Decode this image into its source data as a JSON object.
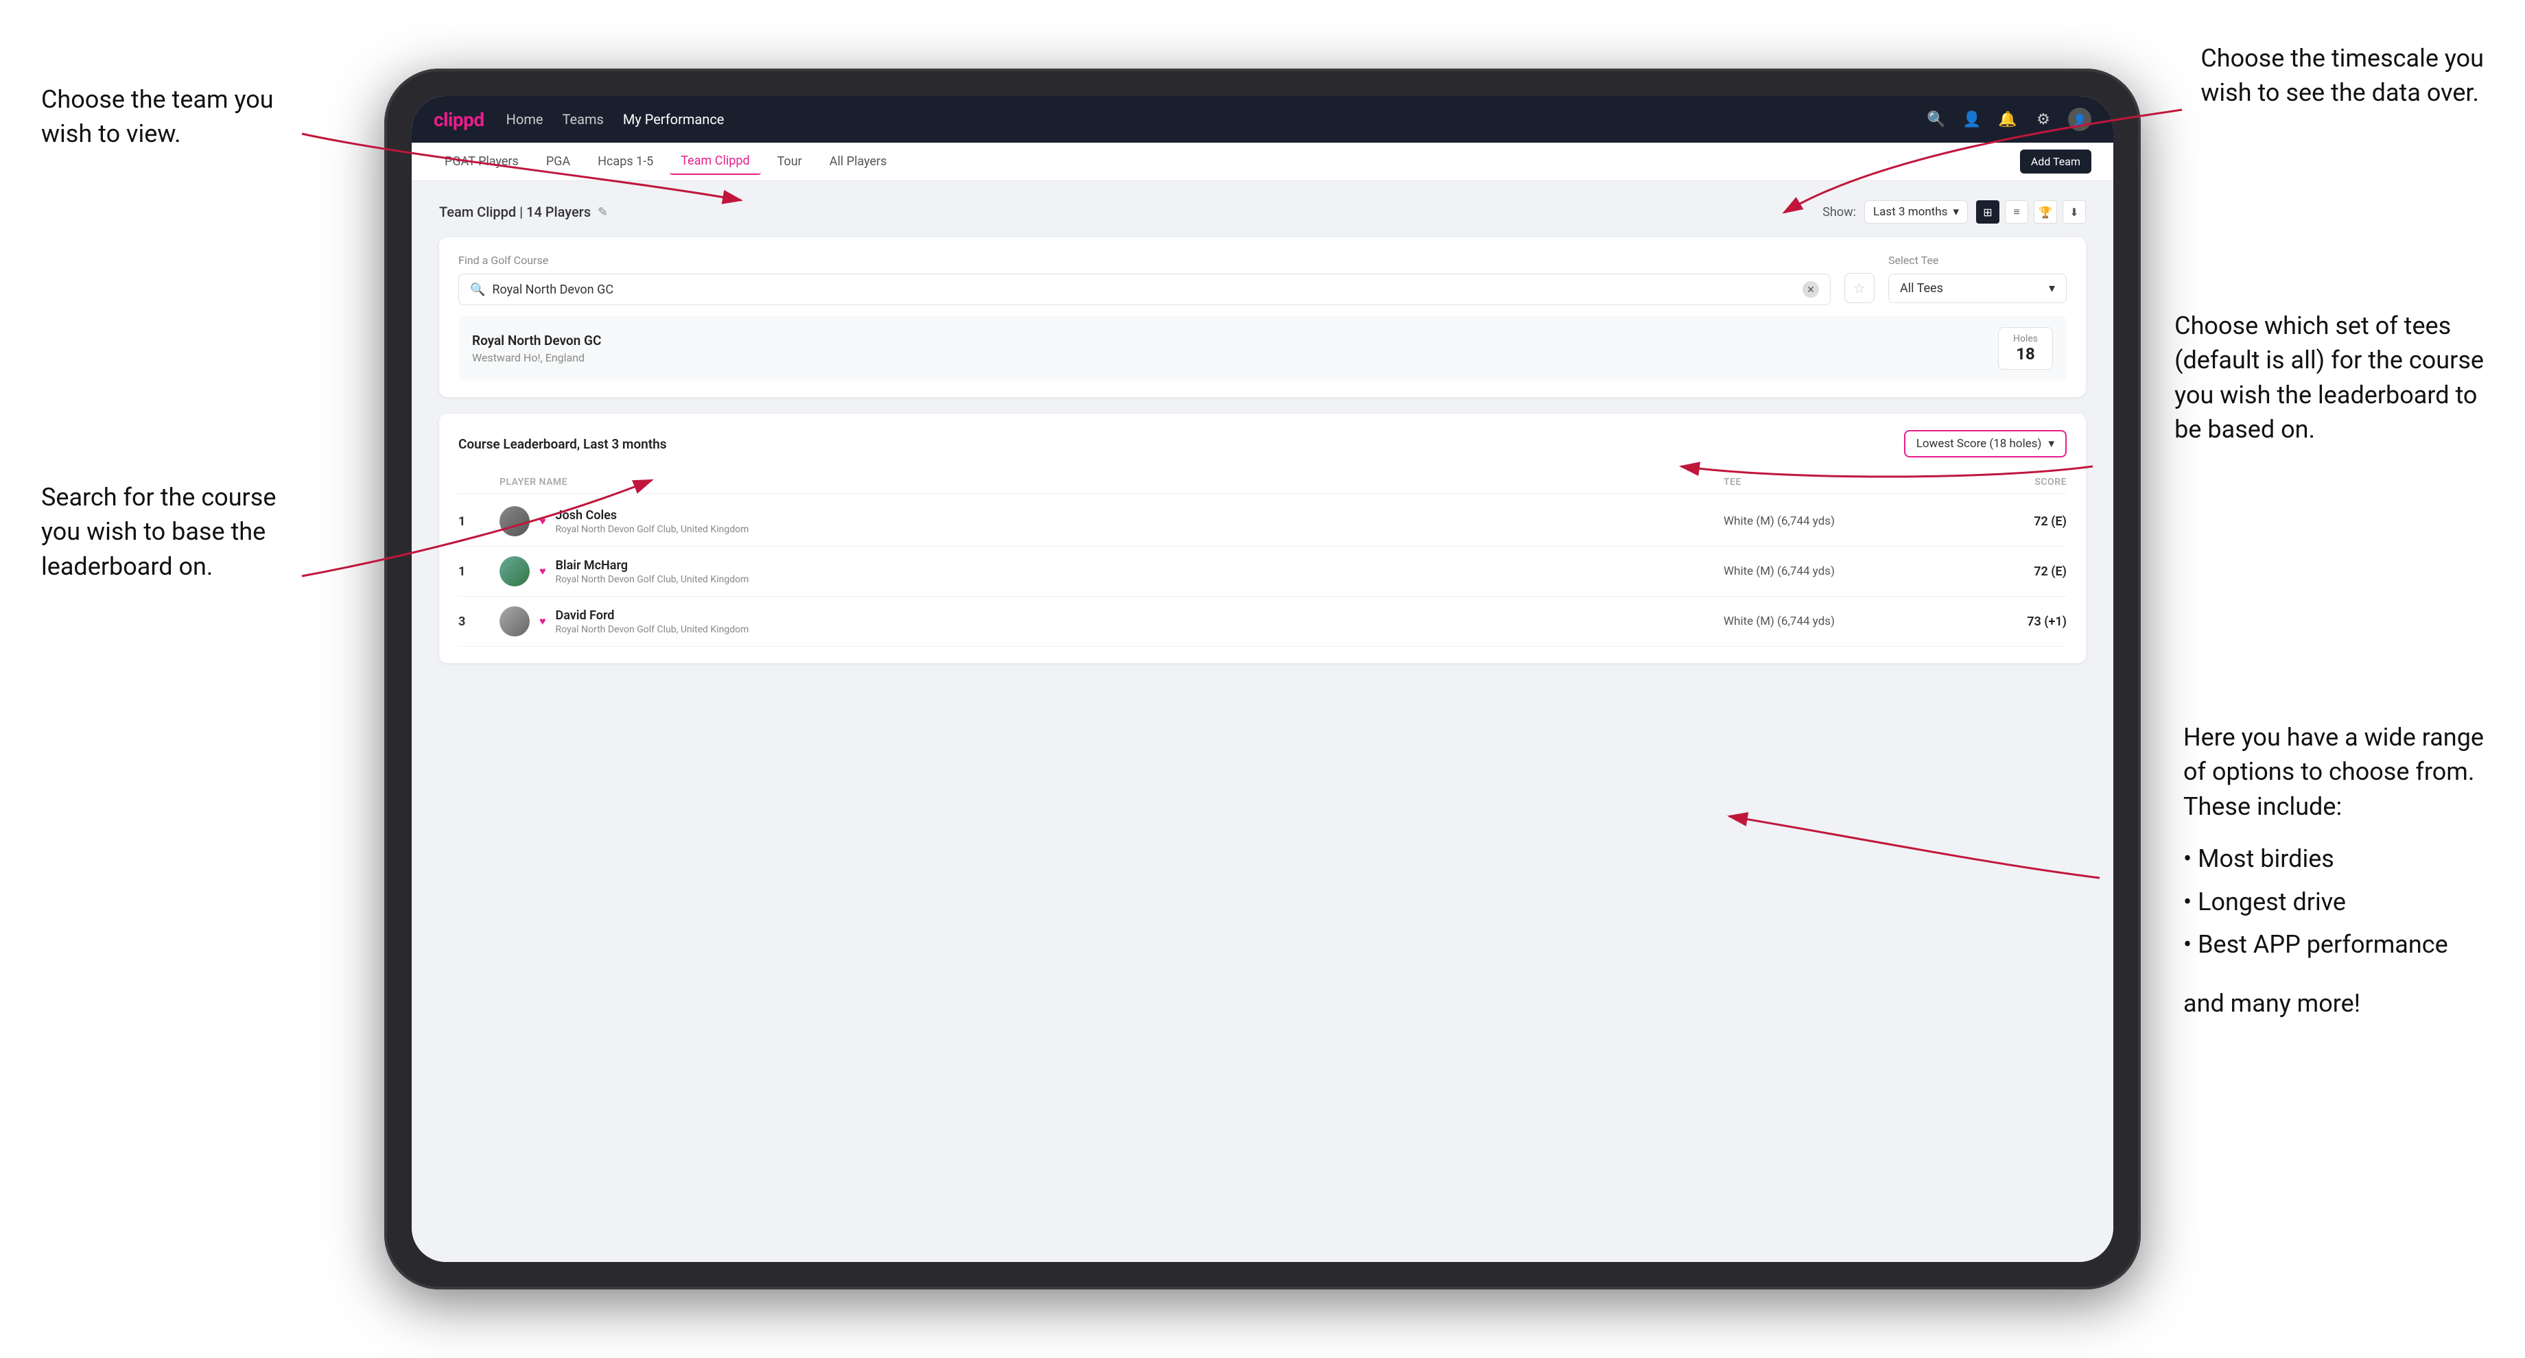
{
  "annotations": {
    "top_left_title": "Choose the team you\nwish to view.",
    "top_right_title": "Choose the timescale you\nwish to see the data over.",
    "mid_left_title": "Search for the course\nyou wish to base the\nleaderboard on.",
    "right_tee_title": "Choose which set of tees\n(default is all) for the course\nyou wish the leaderboard to\nbe based on.",
    "bottom_right_title": "Here you have a wide range\nof options to choose from.\nThese include:",
    "bullet_items": [
      "Most birdies",
      "Longest drive",
      "Best APP performance"
    ],
    "and_more": "and many more!"
  },
  "navbar": {
    "brand": "clippd",
    "links": [
      "Home",
      "Teams",
      "My Performance"
    ],
    "active_link": "My Performance"
  },
  "subnav": {
    "items": [
      "PGAT Players",
      "PGA",
      "Hcaps 1-5",
      "Team Clippd",
      "Tour",
      "All Players"
    ],
    "active_item": "Team Clippd",
    "add_team_label": "Add Team"
  },
  "team_header": {
    "title": "Team Clippd",
    "player_count": "14 Players",
    "show_label": "Show:",
    "time_period": "Last 3 months"
  },
  "course_finder": {
    "label": "Find a Golf Course",
    "search_value": "Royal North Devon GC",
    "tee_label": "Select Tee",
    "tee_value": "All Tees"
  },
  "course_result": {
    "name": "Royal North Devon GC",
    "location": "Westward Ho!, England",
    "holes_label": "Holes",
    "holes_value": "18"
  },
  "leaderboard": {
    "title": "Course Leaderboard,",
    "subtitle": "Last 3 months",
    "score_type": "Lowest Score (18 holes)",
    "columns": {
      "player_name": "PLAYER NAME",
      "tee": "TEE",
      "score": "SCORE"
    },
    "players": [
      {
        "rank": "1",
        "name": "Josh Coles",
        "club": "Royal North Devon Golf Club, United Kingdom",
        "tee": "White (M) (6,744 yds)",
        "score": "72 (E)"
      },
      {
        "rank": "1",
        "name": "Blair McHarg",
        "club": "Royal North Devon Golf Club, United Kingdom",
        "tee": "White (M) (6,744 yds)",
        "score": "72 (E)"
      },
      {
        "rank": "3",
        "name": "David Ford",
        "club": "Royal North Devon Golf Club, United Kingdom",
        "tee": "White (M) (6,744 yds)",
        "score": "73 (+1)"
      }
    ]
  },
  "icons": {
    "search": "🔍",
    "bell": "🔔",
    "user": "👤",
    "settings": "⚙",
    "star": "☆",
    "chevron_down": "▾",
    "grid": "⊞",
    "list": "≡",
    "trophy": "🏆",
    "download": "⬇",
    "edit": "✎",
    "clear": "✕",
    "heart": "♥"
  },
  "colors": {
    "brand_pink": "#e91e8c",
    "navbar_dark": "#1a1f2e",
    "text_dark": "#222",
    "text_muted": "#888"
  }
}
